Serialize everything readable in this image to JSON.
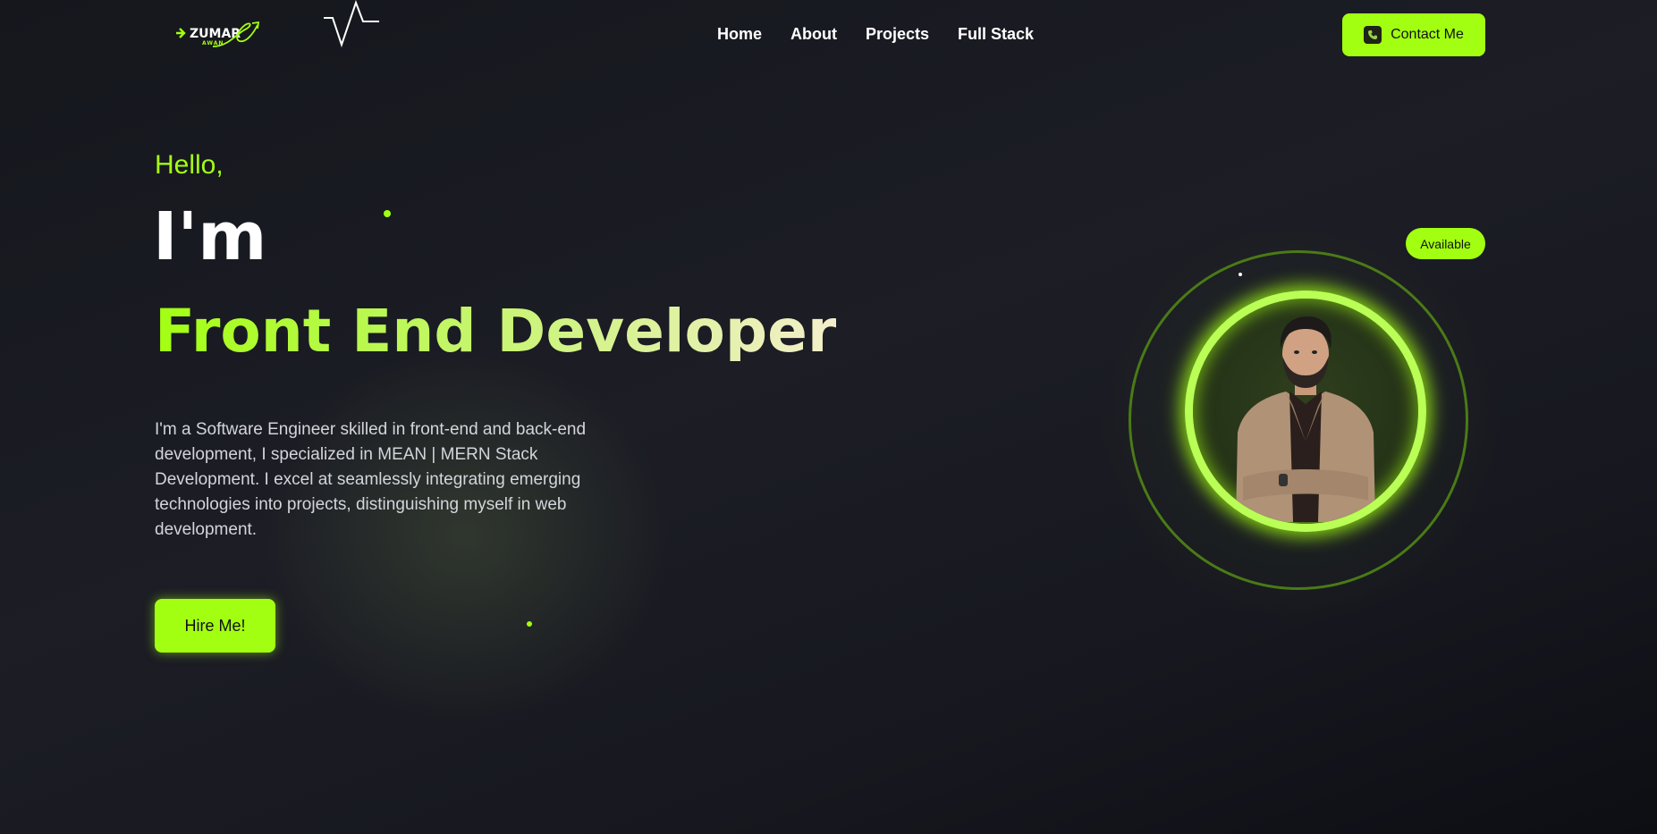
{
  "brand": {
    "name": "ZUMAR",
    "sub": "AWAN",
    "accent": "#a3ff12"
  },
  "nav": {
    "links": [
      "Home",
      "About",
      "Projects",
      "Full Stack"
    ],
    "contact_label": "Contact Me",
    "contact_icon": "phone-icon"
  },
  "hero": {
    "greeting": "Hello,",
    "intro": "I'm",
    "role": "Front End Developer",
    "bio": "I'm a Software Engineer skilled in front-end and back-end development, I specialized in MEAN | MERN Stack Development. I excel at seamlessly integrating emerging technologies into projects, distinguishing myself in web development.",
    "cta_label": "Hire Me!"
  },
  "profile": {
    "status": "Available"
  },
  "colors": {
    "accent": "#a3ff12",
    "background": "#1a1b22",
    "text_primary": "#ffffff",
    "text_secondary": "#d3d5da"
  }
}
